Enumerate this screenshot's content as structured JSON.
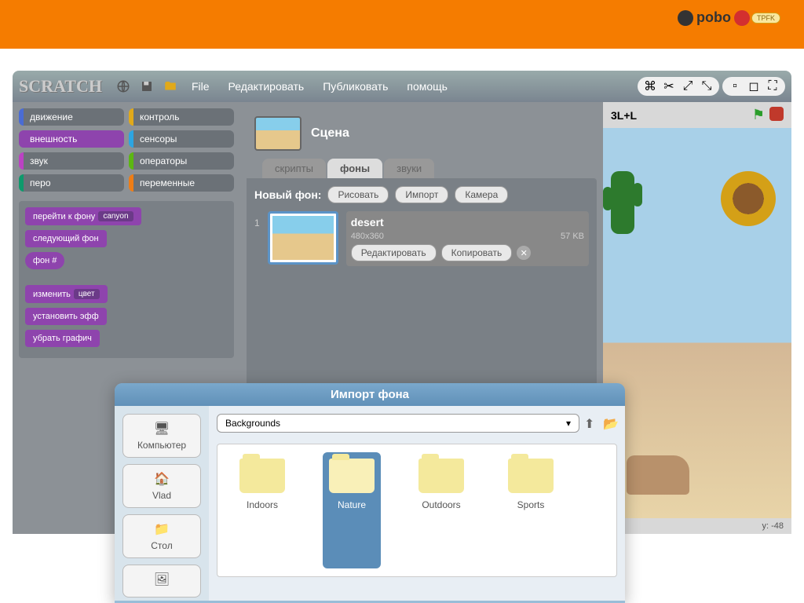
{
  "banner": {
    "brand": "pobo",
    "badge": "TPFK"
  },
  "app": {
    "logo": "SCRATCH",
    "menu": [
      "File",
      "Редактировать",
      "Публиковать",
      "помощь"
    ]
  },
  "palette": {
    "categories": [
      {
        "label": "движение",
        "color": "#4a6cd4"
      },
      {
        "label": "контроль",
        "color": "#e1a91a"
      },
      {
        "label": "внешность",
        "color": "#8e44ad",
        "active": true
      },
      {
        "label": "сенсоры",
        "color": "#2ca5e2"
      },
      {
        "label": "звук",
        "color": "#bb42c3"
      },
      {
        "label": "операторы",
        "color": "#5cb712"
      },
      {
        "label": "перо",
        "color": "#0e9a6c"
      },
      {
        "label": "переменные",
        "color": "#ee7d16"
      }
    ]
  },
  "blocks": {
    "b1_text": "перейти к фону",
    "b1_dropdown": "canyon",
    "b2_text": "следующий фон",
    "b3_text": "фон #",
    "b4_text": "изменить",
    "b4_dropdown": "цвет",
    "b5_text": "установить эфф",
    "b6_text": "убрать графич"
  },
  "sprite": {
    "name": "Сцена"
  },
  "tabs": [
    "скрипты",
    "фоны",
    "звуки"
  ],
  "newbg": {
    "label": "Новый фон:",
    "buttons": [
      "Рисовать",
      "Импорт",
      "Камера"
    ]
  },
  "bgitem": {
    "num": "1",
    "name": "desert",
    "dims": "480x360",
    "size": "57 KB",
    "edit": "Редактировать",
    "copy": "Копировать"
  },
  "stage": {
    "title": "3L+L",
    "coord": "y: -48"
  },
  "dialog": {
    "title": "Импорт фона",
    "sidebar": [
      "Компьютер",
      "Vlad",
      "Стол"
    ],
    "path": "Backgrounds",
    "folders": [
      "Indoors",
      "Nature",
      "Outdoors",
      "Sports"
    ],
    "selected_index": 1
  }
}
